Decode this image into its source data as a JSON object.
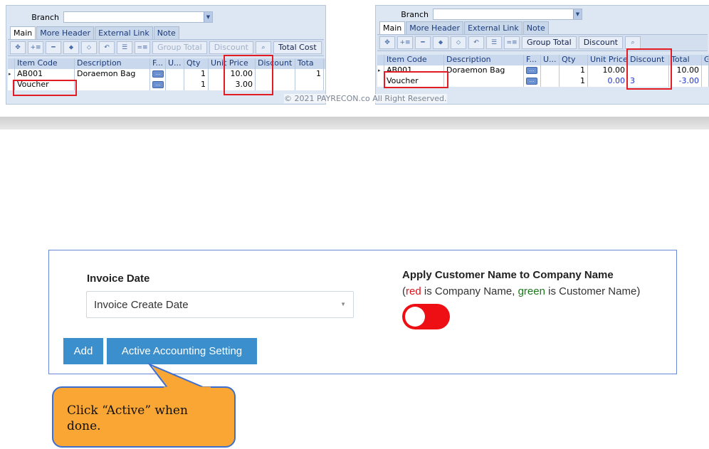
{
  "left_panel": {
    "branch_label": "Branch",
    "tabs": [
      "Main",
      "More Header",
      "External Link",
      "Note"
    ],
    "toolbar": {
      "group_total": "Group Total",
      "discount": "Discount",
      "total_cost": "Total Cost"
    },
    "columns": [
      "Item Code",
      "Description",
      "F...",
      "U...",
      "Qty",
      "Unit Price",
      "Discount",
      "Tota"
    ],
    "rows": [
      {
        "item_code": "AB001",
        "description": "Doraemon Bag",
        "qty": "1",
        "unit_price": "10.00",
        "discount": "",
        "total": "1"
      },
      {
        "item_code": "Voucher",
        "description": "",
        "qty": "1",
        "unit_price": "3.00",
        "discount": "",
        "total": ""
      }
    ]
  },
  "right_panel": {
    "branch_label": "Branch",
    "tabs": [
      "Main",
      "More Header",
      "External Link",
      "Note"
    ],
    "toolbar": {
      "group_total": "Group Total",
      "discount": "Discount"
    },
    "columns": [
      "Item Code",
      "Description",
      "F...",
      "U...",
      "Qty",
      "Unit Price",
      "Discount",
      "Total",
      "G"
    ],
    "rows": [
      {
        "item_code": "AB001",
        "description": "Doraemon Bag",
        "qty": "1",
        "unit_price": "10.00",
        "discount": "",
        "total": "10.00"
      },
      {
        "item_code": "Voucher",
        "description": "",
        "qty": "1",
        "unit_price": "0.00",
        "discount": "3",
        "total": "-3.00"
      }
    ]
  },
  "copyright": "© 2021 PAYRECON.co All Right Reserved.",
  "settings": {
    "invoice_date_label": "Invoice Date",
    "invoice_date_value": "Invoice Create Date",
    "apply_title": "Apply Customer Name to Company Name",
    "apply_paren_open": "(",
    "apply_red": "red",
    "apply_mid": " is Company Name, ",
    "apply_green": "green",
    "apply_end": " is Customer Name)",
    "add_button": "Add",
    "active_button": "Active Accounting Setting"
  },
  "callout_text": "Click “Active” when done.",
  "colors": {
    "accent_blue": "#3a8fcc",
    "toggle_red": "#ee0f14",
    "callout_orange": "#f9a635",
    "highlight_red": "#e31b23"
  }
}
